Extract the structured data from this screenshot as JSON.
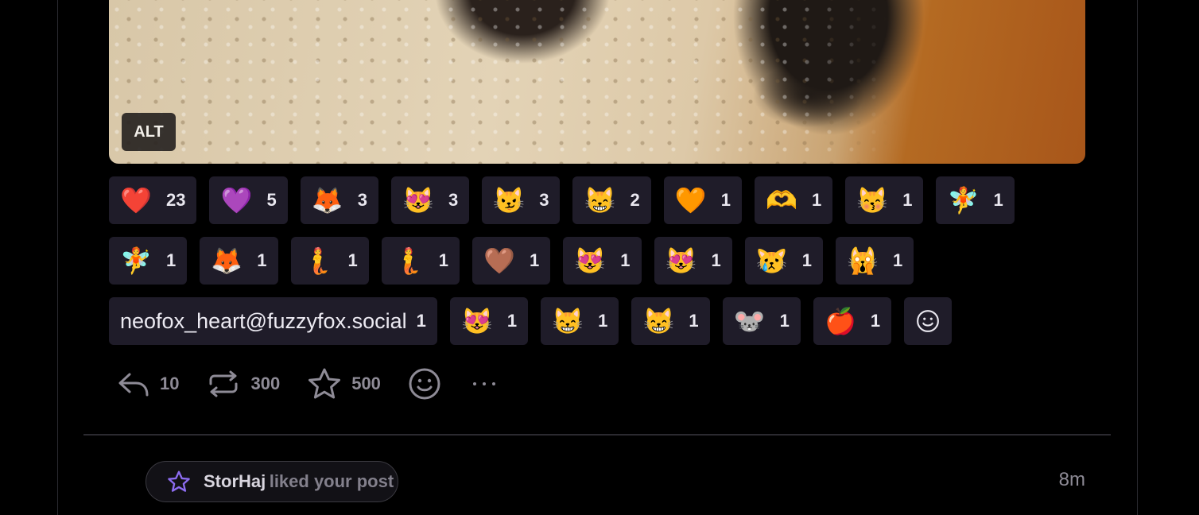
{
  "media": {
    "alt_label": "ALT"
  },
  "reactions": [
    {
      "emoji": "❤️",
      "count": "23"
    },
    {
      "emoji": "💜",
      "count": "5"
    },
    {
      "emoji": "🦊",
      "count": "3"
    },
    {
      "emoji": "😻",
      "count": "3"
    },
    {
      "emoji": "😼",
      "count": "3"
    },
    {
      "emoji": "😸",
      "count": "2"
    },
    {
      "emoji": "🧡",
      "count": "1"
    },
    {
      "emoji": "🫶",
      "count": "1"
    },
    {
      "emoji": "😽",
      "count": "1"
    },
    {
      "emoji": "🧚",
      "count": "1"
    },
    {
      "emoji": "🧚",
      "count": "1"
    },
    {
      "emoji": "🦊",
      "count": "1"
    },
    {
      "emoji": "🧜",
      "count": "1"
    },
    {
      "emoji": "🧜",
      "count": "1"
    },
    {
      "emoji": "🤎",
      "count": "1"
    },
    {
      "emoji": "😻",
      "count": "1"
    },
    {
      "emoji": "😻",
      "count": "1"
    },
    {
      "emoji": "😿",
      "count": "1"
    },
    {
      "emoji": "🙀",
      "count": "1"
    },
    {
      "name": "neofox_heart@fuzzyfox.social",
      "count": "1"
    },
    {
      "emoji": "😻",
      "count": "1"
    },
    {
      "emoji": "😸",
      "count": "1"
    },
    {
      "emoji": "😸",
      "count": "1"
    },
    {
      "emoji": "🐭",
      "count": "1"
    },
    {
      "emoji": "🍎",
      "count": "1"
    }
  ],
  "actions": {
    "reply_count": "10",
    "boost_count": "300",
    "favourite_count": "500"
  },
  "notification": {
    "user": "StorHaj",
    "text": "liked your post",
    "time": "8m"
  },
  "colors": {
    "accent": "#8c6cf0",
    "chip_bg": "#1f1c29"
  }
}
